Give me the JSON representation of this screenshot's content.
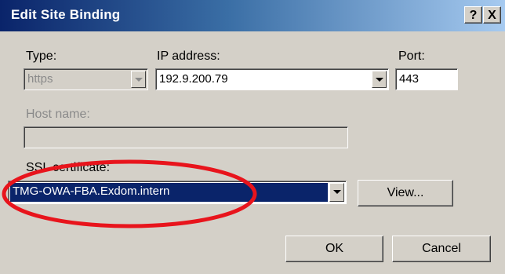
{
  "window": {
    "title": "Edit Site Binding",
    "help_button": "?",
    "close_button": "X"
  },
  "type": {
    "label": "Type:",
    "value": "https"
  },
  "ip_address": {
    "label": "IP address:",
    "value": "192.9.200.79"
  },
  "port": {
    "label": "Port:",
    "value": "443"
  },
  "host_name": {
    "label": "Host name:",
    "value": ""
  },
  "ssl_certificate": {
    "label": "SSL certificate:",
    "value": "TMG-OWA-FBA.Exdom.intern",
    "view_button": "View..."
  },
  "buttons": {
    "ok": "OK",
    "cancel": "Cancel"
  },
  "annotation": {
    "color": "#e8141c"
  }
}
